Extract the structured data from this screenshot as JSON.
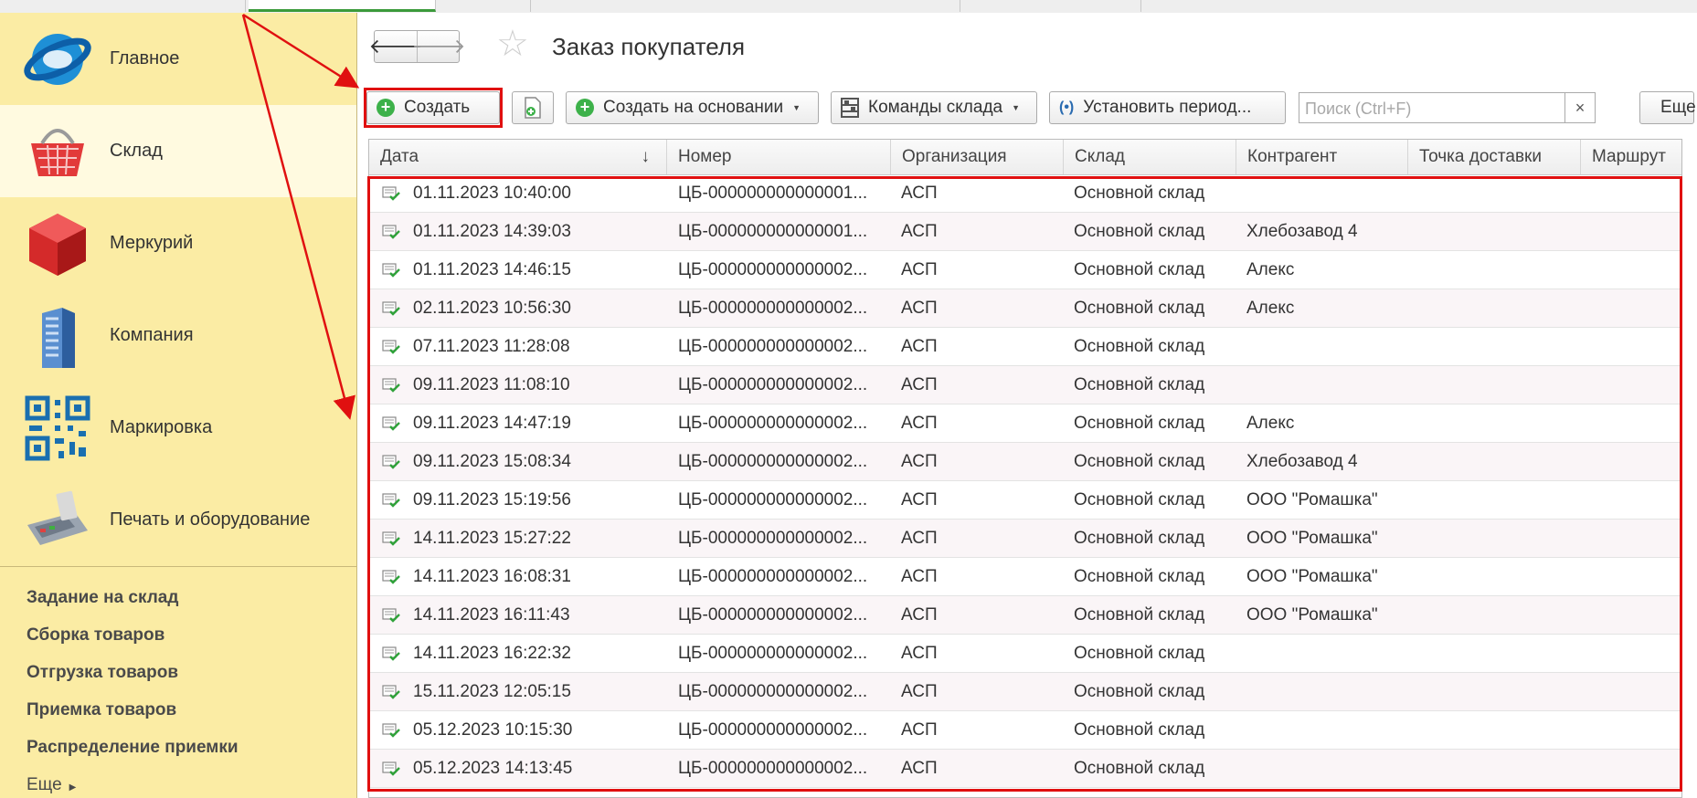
{
  "window": {
    "title": "Заказ покупателя"
  },
  "sidebar": {
    "sections": [
      {
        "label": "Главное",
        "icon": "globe-logo-icon"
      },
      {
        "label": "Склад",
        "icon": "shopping-basket-icon"
      },
      {
        "label": "Меркурий",
        "icon": "red-cube-icon"
      },
      {
        "label": "Компания",
        "icon": "office-building-icon"
      },
      {
        "label": "Маркировка",
        "icon": "qr-code-icon"
      },
      {
        "label": "Печать и оборудование",
        "icon": "card-terminal-icon"
      }
    ],
    "commands": [
      "Задание на склад",
      "Сборка товаров",
      "Отгрузка товаров",
      "Приемка товаров",
      "Распределение приемки"
    ],
    "more_label": "Еще"
  },
  "toolbar": {
    "create": "Создать",
    "create_based": "Создать на основании",
    "warehouse_cmds": "Команды склада",
    "set_period": "Установить период...",
    "search_placeholder": "Поиск (Ctrl+F)",
    "clear": "×",
    "more": "Еще"
  },
  "table": {
    "columns": [
      "Дата",
      "Номер",
      "Организация",
      "Склад",
      "Контрагент",
      "Точка доставки",
      "Маршрут"
    ],
    "sort_indicator": "↓",
    "rows": [
      [
        "01.11.2023 10:40:00",
        "ЦБ-000000000000001...",
        "АСП",
        "Основной склад",
        ""
      ],
      [
        "01.11.2023 14:39:03",
        "ЦБ-000000000000001...",
        "АСП",
        "Основной склад",
        "Хлебозавод 4"
      ],
      [
        "01.11.2023 14:46:15",
        "ЦБ-000000000000002...",
        "АСП",
        "Основной склад",
        "Алекс"
      ],
      [
        "02.11.2023 10:56:30",
        "ЦБ-000000000000002...",
        "АСП",
        "Основной склад",
        "Алекс"
      ],
      [
        "07.11.2023 11:28:08",
        "ЦБ-000000000000002...",
        "АСП",
        "Основной склад",
        ""
      ],
      [
        "09.11.2023 11:08:10",
        "ЦБ-000000000000002...",
        "АСП",
        "Основной склад",
        ""
      ],
      [
        "09.11.2023 14:47:19",
        "ЦБ-000000000000002...",
        "АСП",
        "Основной склад",
        "Алекс"
      ],
      [
        "09.11.2023 15:08:34",
        "ЦБ-000000000000002...",
        "АСП",
        "Основной склад",
        "Хлебозавод 4"
      ],
      [
        "09.11.2023 15:19:56",
        "ЦБ-000000000000002...",
        "АСП",
        "Основной склад",
        "ООО \"Ромашка\""
      ],
      [
        "14.11.2023 15:27:22",
        "ЦБ-000000000000002...",
        "АСП",
        "Основной склад",
        "ООО \"Ромашка\""
      ],
      [
        "14.11.2023 16:08:31",
        "ЦБ-000000000000002...",
        "АСП",
        "Основной склад",
        "ООО \"Ромашка\""
      ],
      [
        "14.11.2023 16:11:43",
        "ЦБ-000000000000002...",
        "АСП",
        "Основной склад",
        "ООО \"Ромашка\""
      ],
      [
        "14.11.2023 16:22:32",
        "ЦБ-000000000000002...",
        "АСП",
        "Основной склад",
        ""
      ],
      [
        "15.11.2023 12:05:15",
        "ЦБ-000000000000002...",
        "АСП",
        "Основной склад",
        ""
      ],
      [
        "05.12.2023 10:15:30",
        "ЦБ-000000000000002...",
        "АСП",
        "Основной склад",
        ""
      ],
      [
        "05.12.2023 14:13:45",
        "ЦБ-000000000000002...",
        "АСП",
        "Основной склад",
        ""
      ]
    ]
  },
  "colors": {
    "highlight": "#e01010",
    "sidebar_bg": "#fbeca4",
    "accent_green": "#3db14a"
  }
}
